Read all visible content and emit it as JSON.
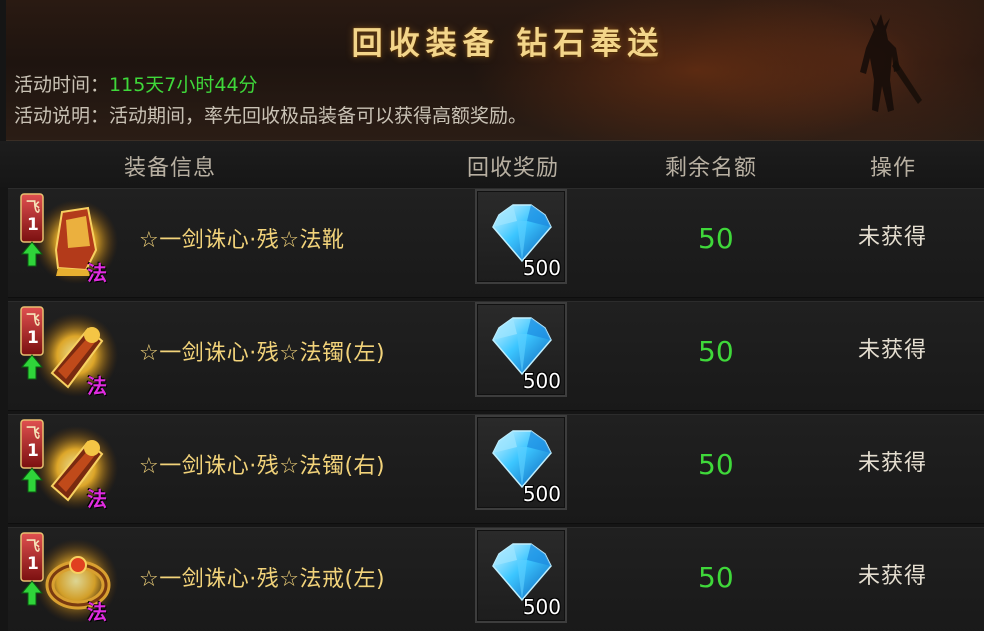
{
  "banner": {
    "title": "回收装备  钻石奉送",
    "time_label": "活动时间：",
    "time_value": "115天7小时44分",
    "desc_label": "活动说明：",
    "desc_value": "活动期间，率先回收极品装备可以获得高额奖励。"
  },
  "table": {
    "headers": {
      "info": "装备信息",
      "reward": "回收奖励",
      "remaining": "剩余名额",
      "operation": "操作"
    },
    "rows": [
      {
        "name": "☆一剑诛心·残☆法靴",
        "tag_fly": "飞",
        "tag_level": "1",
        "tag_class": "法",
        "reward_icon": "diamond-icon",
        "reward_qty": "500",
        "remaining": "50",
        "status": "未获得"
      },
      {
        "name": "☆一剑诛心·残☆法镯(左)",
        "tag_fly": "飞",
        "tag_level": "1",
        "tag_class": "法",
        "reward_icon": "diamond-icon",
        "reward_qty": "500",
        "remaining": "50",
        "status": "未获得"
      },
      {
        "name": "☆一剑诛心·残☆法镯(右)",
        "tag_fly": "飞",
        "tag_level": "1",
        "tag_class": "法",
        "reward_icon": "diamond-icon",
        "reward_qty": "500",
        "remaining": "50",
        "status": "未获得"
      },
      {
        "name": "☆一剑诛心·残☆法戒(左)",
        "tag_fly": "飞",
        "tag_level": "1",
        "tag_class": "法",
        "reward_icon": "diamond-icon",
        "reward_qty": "500",
        "remaining": "50",
        "status": "未获得"
      }
    ]
  },
  "colors": {
    "title_gold": "#f3d58a",
    "value_green": "#3fd83a",
    "item_name_gold": "#f2d37a",
    "class_tag_magenta": "#e02ce0"
  }
}
